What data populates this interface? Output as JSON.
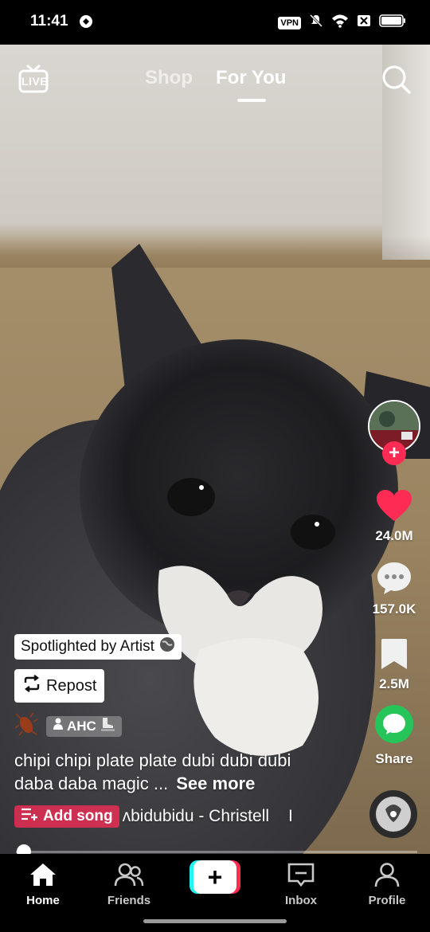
{
  "status_bar": {
    "time": "11:41",
    "vpn": "VPN",
    "icons": [
      "vpn-icon",
      "mute-icon",
      "wifi-icon",
      "no-sim-icon",
      "battery-icon"
    ]
  },
  "top_nav": {
    "live_label": "LIVE",
    "tabs": [
      {
        "label": "Shop",
        "active": false
      },
      {
        "label": "For You",
        "active": true
      }
    ]
  },
  "actions": {
    "likes": "24.0M",
    "comments": "157.0K",
    "saves": "2.5M",
    "share_label": "Share"
  },
  "caption": {
    "spotlight": "Spotlighted by Artist",
    "repost": "Repost",
    "author_tag": "AHC",
    "text": "chipi chipi plate plate dubi dubi dubi daba daba magic ...",
    "see_more": "See more",
    "add_song": "Add song",
    "song": "ʌbidubidu - Christell",
    "song_tail": "I"
  },
  "progress": {
    "fraction": 0.02
  },
  "bottom_nav": [
    {
      "label": "Home",
      "active": true
    },
    {
      "label": "Friends",
      "active": false
    },
    {
      "label": "",
      "active": false
    },
    {
      "label": "Inbox",
      "active": false
    },
    {
      "label": "Profile",
      "active": false
    }
  ],
  "colors": {
    "accent_red": "#fe2c55",
    "accent_cyan": "#25f4ee",
    "like_red": "#fe2c55",
    "share_green": "#25c55a"
  }
}
